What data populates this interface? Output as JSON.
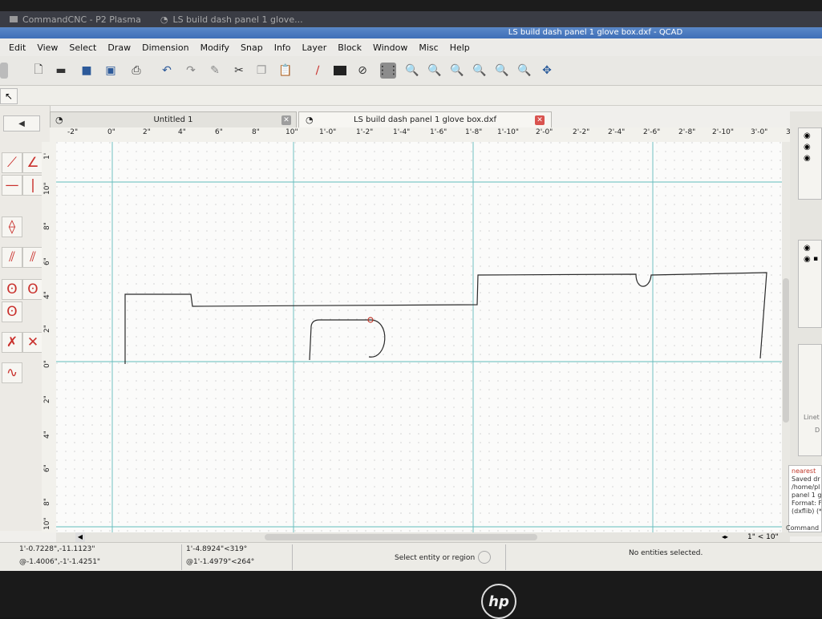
{
  "taskbar": {
    "items": [
      "CommandCNC - P2 Plasma",
      "LS build dash panel 1 glove..."
    ]
  },
  "window": {
    "title": "LS build dash panel 1 glove box.dxf - QCAD"
  },
  "menu": [
    "Edit",
    "View",
    "Select",
    "Draw",
    "Dimension",
    "Modify",
    "Snap",
    "Info",
    "Layer",
    "Block",
    "Window",
    "Misc",
    "Help"
  ],
  "toolbar": {
    "icons": [
      "new-file-icon",
      "open-folder-icon",
      "save-icon",
      "save-as-icon",
      "print-icon",
      "undo-icon",
      "redo-icon",
      "pencil-icon",
      "cut-icon",
      "copy-icon",
      "paste-icon",
      "pen-icon",
      "color-swatch-icon",
      "no-entry-icon",
      "grid-icon",
      "zoom-in-icon",
      "zoom-out-icon",
      "zoom-auto-icon",
      "zoom-previous-icon",
      "zoom-window-icon",
      "zoom-pan-icon",
      "zoom-redraw-icon"
    ]
  },
  "tabs": [
    {
      "label": "Untitled 1",
      "active": false
    },
    {
      "label": "LS build dash panel 1 glove box.dxf",
      "active": true
    }
  ],
  "ruler": {
    "horizontal": [
      "-2\"",
      "0\"",
      "2\"",
      "4\"",
      "6\"",
      "8\"",
      "10\"",
      "1'-0\"",
      "1'-2\"",
      "1'-4\"",
      "1'-6\"",
      "1'-8\"",
      "1'-10\"",
      "2'-0\"",
      "2'-2\"",
      "2'-4\"",
      "2'-6\"",
      "2'-8\"",
      "2'-10\"",
      "3'-0\"",
      "3'"
    ],
    "vertical": [
      "1'",
      "10\"",
      "8\"",
      "6\"",
      "4\"",
      "2\"",
      "0\"",
      "2\"",
      "4\"",
      "6\"",
      "8\"",
      "10\""
    ]
  },
  "grid_info": "1\" < 10\"",
  "command_history": [
    "nearest",
    "Saved dr",
    "/home/pl",
    "panel 1 g",
    "Format: F",
    "(dxflib) (*"
  ],
  "command_label": "Command",
  "dock_labels": [
    "Linet",
    "D"
  ],
  "status": {
    "abs_coord": "1'-0.7228\",-11.1123\"",
    "rel_coord": "@-1.4006\",-1'-1.4251\"",
    "polar_coord": "1'-4.8924\"<319°",
    "rel_polar": "@1'-1.4979\"<264°",
    "mouse_hint": "Select entity or region",
    "selection": "No entities selected."
  },
  "brand": "hp",
  "colors": {
    "titlebar": "#4a7bc0",
    "grid_line": "#4fb6b6",
    "entity": "#2a2a2a",
    "tool_red": "#c9302c"
  }
}
